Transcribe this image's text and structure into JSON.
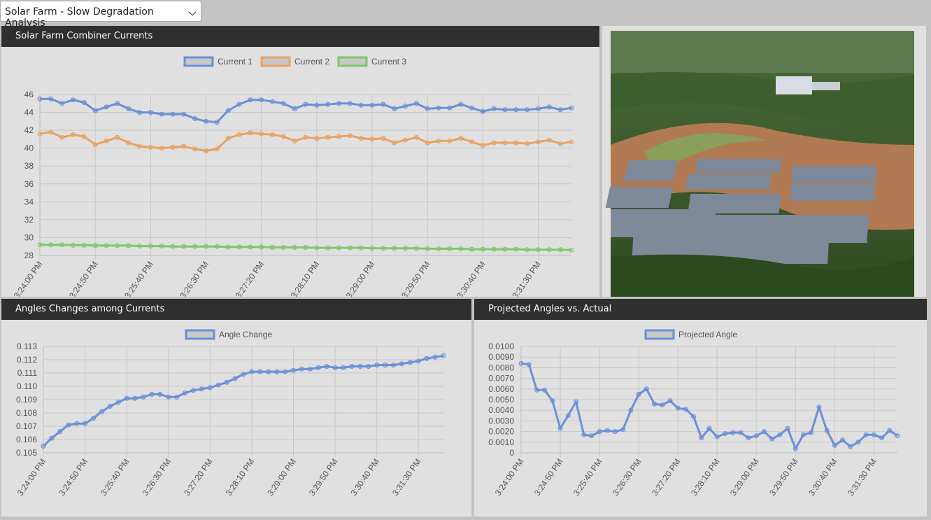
{
  "dropdown": {
    "selected": "Solar Farm - Slow Degradation Analysis"
  },
  "panels": {
    "currents": {
      "title": "Solar Farm Combiner Currents"
    },
    "angles": {
      "title": "Angles Changes among Currents"
    },
    "projected": {
      "title": "Projected Angles vs. Actual"
    },
    "photo": {
      "subject": "aerial-solar-farm-photo"
    }
  },
  "colors": {
    "blue": "#6b8fd8",
    "orange": "#e8a262",
    "green": "#7ec86a"
  },
  "chart_data": [
    {
      "type": "line",
      "x_tick_labels": [
        "3:24:00 PM",
        "3:24:50 PM",
        "3:25:40 PM",
        "3:26:30 PM",
        "3:27:20 PM",
        "3:28:10 PM",
        "3:29:00 PM",
        "3:29:50 PM",
        "3:30:40 PM",
        "3:31:30 PM"
      ],
      "ylim": [
        28,
        46
      ],
      "yticks": [
        28,
        30,
        32,
        34,
        36,
        38,
        40,
        42,
        44,
        46
      ],
      "legend_position": "top-center",
      "grid": true,
      "series": [
        {
          "name": "Current 1",
          "color": "#6b8fd8",
          "values": [
            45.5,
            45.5,
            45.0,
            45.4,
            45.1,
            44.2,
            44.6,
            45.0,
            44.4,
            44.0,
            44.0,
            43.8,
            43.8,
            43.8,
            43.3,
            43.0,
            42.9,
            44.2,
            44.9,
            45.4,
            45.4,
            45.2,
            45.0,
            44.4,
            44.9,
            44.8,
            44.9,
            45.0,
            45.0,
            44.8,
            44.8,
            44.9,
            44.4,
            44.7,
            45.0,
            44.4,
            44.5,
            44.5,
            44.9,
            44.5,
            44.1,
            44.4,
            44.3,
            44.3,
            44.3,
            44.4,
            44.6,
            44.3,
            44.5
          ]
        },
        {
          "name": "Current 2",
          "color": "#e8a262",
          "values": [
            41.6,
            41.8,
            41.2,
            41.5,
            41.3,
            40.4,
            40.8,
            41.2,
            40.6,
            40.2,
            40.1,
            40.0,
            40.1,
            40.2,
            39.9,
            39.7,
            39.9,
            41.1,
            41.5,
            41.7,
            41.6,
            41.5,
            41.3,
            40.8,
            41.2,
            41.1,
            41.2,
            41.3,
            41.4,
            41.1,
            41.0,
            41.1,
            40.6,
            40.9,
            41.2,
            40.6,
            40.8,
            40.8,
            41.1,
            40.7,
            40.3,
            40.6,
            40.6,
            40.6,
            40.5,
            40.7,
            40.9,
            40.5,
            40.7
          ]
        },
        {
          "name": "Current 3",
          "color": "#7ec86a",
          "values": [
            29.2,
            29.2,
            29.2,
            29.15,
            29.15,
            29.1,
            29.1,
            29.1,
            29.1,
            29.05,
            29.05,
            29.05,
            29.0,
            29.0,
            29.0,
            29.0,
            29.0,
            28.95,
            28.95,
            28.95,
            28.95,
            28.9,
            28.9,
            28.9,
            28.9,
            28.85,
            28.85,
            28.85,
            28.85,
            28.85,
            28.8,
            28.8,
            28.8,
            28.8,
            28.8,
            28.75,
            28.75,
            28.75,
            28.75,
            28.7,
            28.7,
            28.7,
            28.7,
            28.7,
            28.65,
            28.65,
            28.65,
            28.65,
            28.6
          ]
        }
      ]
    },
    {
      "type": "line",
      "x_tick_labels": [
        "3:24:00 PM",
        "3:24:50 PM",
        "3:25:40 PM",
        "3:26:30 PM",
        "3:27:20 PM",
        "3:28:10 PM",
        "3:29:00 PM",
        "3:29:50 PM",
        "3:30:40 PM",
        "3:31:30 PM"
      ],
      "ylim": [
        0.105,
        0.113
      ],
      "yticks": [
        "0.105",
        "0.106",
        "0.107",
        "0.108",
        "0.109",
        "0.110",
        "0.111",
        "0.112",
        "0.113"
      ],
      "legend_position": "top-center",
      "grid": true,
      "series": [
        {
          "name": "Angle Change",
          "color": "#6b8fd8",
          "values": [
            0.1055,
            0.1061,
            0.1066,
            0.1071,
            0.1072,
            0.1072,
            0.1076,
            0.1081,
            0.1085,
            0.1088,
            0.1091,
            0.1091,
            0.1092,
            0.1094,
            0.1094,
            0.1092,
            0.1092,
            0.1095,
            0.1097,
            0.1098,
            0.1099,
            0.1101,
            0.1103,
            0.1106,
            0.1109,
            0.1111,
            0.1111,
            0.1111,
            0.1111,
            0.1111,
            0.1112,
            0.1113,
            0.1113,
            0.1114,
            0.1115,
            0.1114,
            0.1114,
            0.1115,
            0.1115,
            0.1115,
            0.1116,
            0.1116,
            0.1116,
            0.1117,
            0.1118,
            0.1119,
            0.1121,
            0.1122,
            0.1123
          ]
        }
      ]
    },
    {
      "type": "line",
      "x_tick_labels": [
        "3:24:00 PM",
        "3:24:50 PM",
        "3:25:40 PM",
        "3:26:30 PM",
        "3:27:20 PM",
        "3:28:10 PM",
        "3:29:00 PM",
        "3:29:50 PM",
        "3:30:40 PM",
        "3:31:30 PM"
      ],
      "ylim": [
        0,
        0.01
      ],
      "yticks": [
        "0",
        "0.0010",
        "0.0020",
        "0.0030",
        "0.0040",
        "0.0050",
        "0.0060",
        "0.0070",
        "0.0080",
        "0.0090",
        "0.0100"
      ],
      "legend_position": "top-center",
      "grid": true,
      "series": [
        {
          "name": "Projected Angle",
          "color": "#6b8fd8",
          "values": [
            0.0084,
            0.0083,
            0.0059,
            0.0059,
            0.0049,
            0.0023,
            0.0035,
            0.0048,
            0.0017,
            0.0016,
            0.002,
            0.0021,
            0.002,
            0.0022,
            0.004,
            0.0055,
            0.006,
            0.0046,
            0.0045,
            0.0049,
            0.0042,
            0.0041,
            0.0034,
            0.0014,
            0.0023,
            0.0015,
            0.0018,
            0.0019,
            0.0019,
            0.0014,
            0.0016,
            0.002,
            0.0013,
            0.0017,
            0.0023,
            0.0004,
            0.0017,
            0.0019,
            0.0043,
            0.0021,
            0.0007,
            0.0012,
            0.0006,
            0.001,
            0.0017,
            0.0017,
            0.0014,
            0.0021,
            0.0016
          ]
        }
      ]
    }
  ]
}
